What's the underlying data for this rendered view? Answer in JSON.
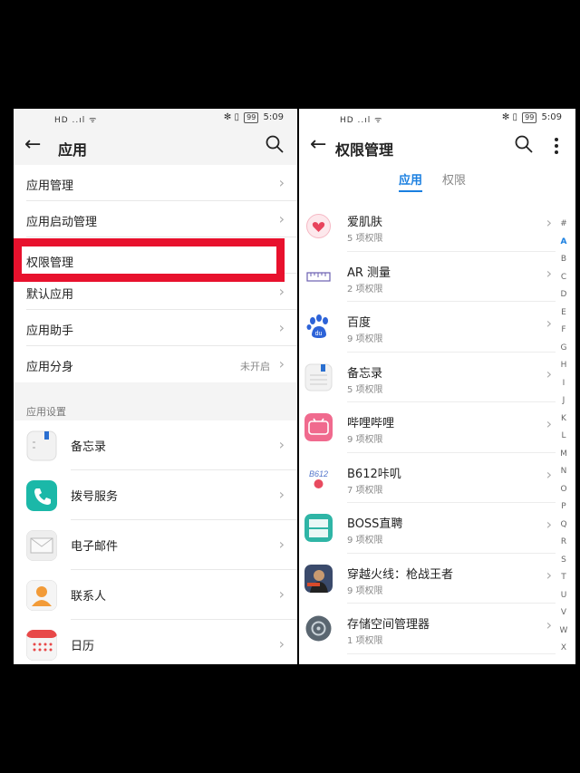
{
  "left": {
    "status": {
      "signal": "HD ..ıl ᯤ",
      "icons": "✻ ▯ ",
      "battery": "99",
      "time": "5:09"
    },
    "appbar": {
      "title": "应用"
    },
    "menu": [
      {
        "label": "应用管理",
        "value": ""
      },
      {
        "label": "应用启动管理",
        "value": ""
      },
      {
        "label": "权限管理",
        "value": ""
      },
      {
        "label": "默认应用",
        "value": ""
      },
      {
        "label": "应用助手",
        "value": ""
      },
      {
        "label": "应用分身",
        "value": "未开启"
      }
    ],
    "section_label": "应用设置",
    "apps": [
      {
        "label": "备忘录",
        "icon": "memo-icon",
        "color": "#f2f2f2"
      },
      {
        "label": "拨号服务",
        "icon": "phone-icon",
        "color": "#1bb8a8"
      },
      {
        "label": "电子邮件",
        "icon": "mail-icon",
        "color": "#eeeeee"
      },
      {
        "label": "联系人",
        "icon": "contacts-icon",
        "color": "#f29b38"
      },
      {
        "label": "日历",
        "icon": "calendar-icon",
        "color": "#f5f5f5"
      }
    ]
  },
  "right": {
    "status": {
      "signal": "HD ..ıl ᯤ",
      "icons": "✻ ▯ ",
      "battery": "99",
      "time": "5:09"
    },
    "appbar": {
      "title": "权限管理"
    },
    "tabs": {
      "active": "应用",
      "inactive": "权限"
    },
    "apps": [
      {
        "name": "爱肌肤",
        "count": "5 项权限",
        "icon": "heart-icon",
        "color": "#ffffff"
      },
      {
        "name": "AR 测量",
        "count": "2 项权限",
        "icon": "ruler-icon",
        "color": "#ffffff"
      },
      {
        "name": "百度",
        "count": "9 项权限",
        "icon": "baidu-paw-icon",
        "color": "#ffffff"
      },
      {
        "name": "备忘录",
        "count": "5 项权限",
        "icon": "memo-icon",
        "color": "#f2f2f2"
      },
      {
        "name": "哔哩哔哩",
        "count": "9 项权限",
        "icon": "bilibili-icon",
        "color": "#f06a8e"
      },
      {
        "name": "B612咔叽",
        "count": "7 项权限",
        "icon": "b612-icon",
        "color": "#ffffff"
      },
      {
        "name": "BOSS直聘",
        "count": "9 项权限",
        "icon": "boss-icon",
        "color": "#2fb5a6"
      },
      {
        "name": "穿越火线：枪战王者",
        "count": "9 项权限",
        "icon": "game-icon",
        "color": "#3a4a6b"
      },
      {
        "name": "存储空间管理器",
        "count": "1 项权限",
        "icon": "storage-icon",
        "color": "#5a6670"
      }
    ],
    "index_letters": [
      "#",
      "A",
      "B",
      "C",
      "D",
      "E",
      "F",
      "G",
      "H",
      "I",
      "J",
      "K",
      "L",
      "M",
      "N",
      "O",
      "P",
      "Q",
      "R",
      "S",
      "T",
      "U",
      "V",
      "W",
      "X"
    ],
    "index_active": "A"
  },
  "highlight_color": "#e8112d",
  "accent_color": "#1a7fe0"
}
